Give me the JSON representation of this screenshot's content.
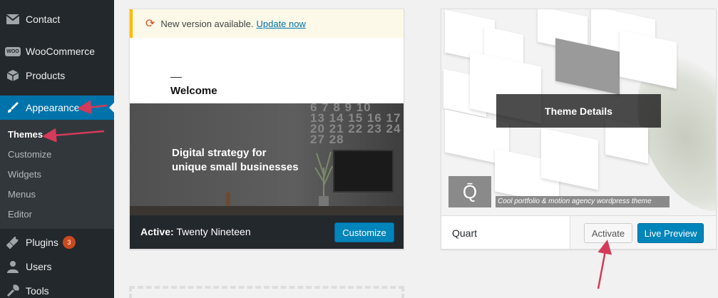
{
  "sidebar": {
    "items": [
      {
        "label": "Contact",
        "icon": "envelope-icon"
      },
      {
        "label": "WooCommerce",
        "icon": "woocommerce-icon"
      },
      {
        "label": "Products",
        "icon": "box-icon"
      },
      {
        "label": "Appearance",
        "icon": "paintbrush-icon"
      },
      {
        "label": "Plugins",
        "icon": "plug-icon",
        "badge": "3"
      },
      {
        "label": "Users",
        "icon": "user-icon"
      },
      {
        "label": "Tools",
        "icon": "wrench-icon"
      }
    ],
    "submenu": [
      "Themes",
      "Customize",
      "Widgets",
      "Menus",
      "Editor"
    ],
    "woo_icon_text": "WOO"
  },
  "themes": {
    "active": {
      "notice_text": "New version available.",
      "notice_link": "Update now",
      "preview_welcome": "Welcome",
      "preview_headline_1": "Digital strategy for",
      "preview_headline_2": "unique small businesses",
      "calendar": [
        "6 7 8 9 10",
        "13 14 15 16 17",
        "20 21 22 23 24",
        "27 28"
      ],
      "active_prefix": "Active:",
      "name": "Twenty Nineteen",
      "customize_label": "Customize"
    },
    "quart": {
      "name": "Quart",
      "details_label": "Theme Details",
      "logo_letter": "Q̄",
      "tagline": "Cool portfolio & motion agency wordpress theme",
      "activate_label": "Activate",
      "live_preview_label": "Live Preview"
    }
  },
  "colors": {
    "sidebar_bg": "#23282d",
    "active_menu": "#0073aa",
    "primary_button": "#0085ba",
    "annotation_arrow": "#d63a5a",
    "notice_border": "#ffb900"
  }
}
